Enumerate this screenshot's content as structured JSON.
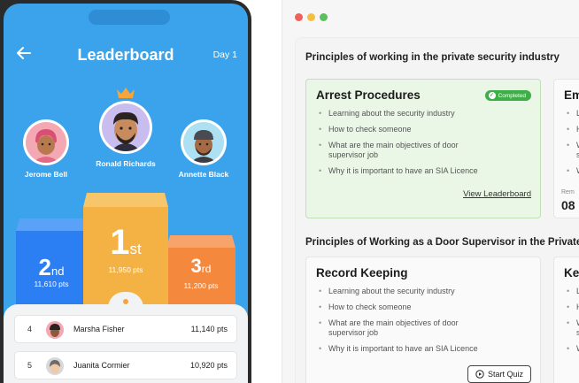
{
  "phone": {
    "title": "Leaderboard",
    "day": "Day 1",
    "top3": [
      {
        "name": "Ronald Richards",
        "rank_num": "1",
        "rank_suffix": "st",
        "points": "11,950 pts"
      },
      {
        "name": "Jerome Bell",
        "rank_num": "2",
        "rank_suffix": "nd",
        "points": "11,610 pts"
      },
      {
        "name": "Annette Black",
        "rank_num": "3",
        "rank_suffix": "rd",
        "points": "11,200 pts"
      }
    ],
    "list": [
      {
        "pos": "4",
        "name": "Marsha Fisher",
        "points": "11,140 pts"
      },
      {
        "pos": "5",
        "name": "Juanita Cormier",
        "points": "10,920 pts"
      }
    ]
  },
  "course": {
    "section1_title": "Principles of working in the private security industry",
    "section2_title": "Principles of Working as a Door Supervisor in the Private Sec",
    "arrest": {
      "title": "Arrest Procedures",
      "badge": "Completed",
      "items": [
        "Learning about the security industry",
        "How to check someone",
        "What are the main objectives of door supervisor job",
        "Why it is important to have an SIA Licence"
      ],
      "link": "View Leaderboard"
    },
    "emergency": {
      "title": "Em",
      "bullets": [
        "L",
        "H",
        "W",
        "W"
      ],
      "extra": [
        "s"
      ],
      "remaining_label": "Rem",
      "remaining_value": "08"
    },
    "record": {
      "title": "Record Keeping",
      "items": [
        "Learning about the security industry",
        "How to check someone",
        "What are the main objectives of door supervisor job",
        "Why it is important to have an SIA Licence"
      ],
      "button": "Start Quiz"
    },
    "keeping": {
      "title": "Kee",
      "bullets": [
        "L",
        "H",
        "W",
        "W"
      ],
      "extra": [
        "s"
      ]
    }
  },
  "colors": {
    "screen_blue": "#3aa3ec",
    "gold": "#f5a53a",
    "first_place": "#f4b244",
    "second_place": "#2c7ff2",
    "third_place": "#f4883d",
    "completed_green": "#3fae49"
  }
}
